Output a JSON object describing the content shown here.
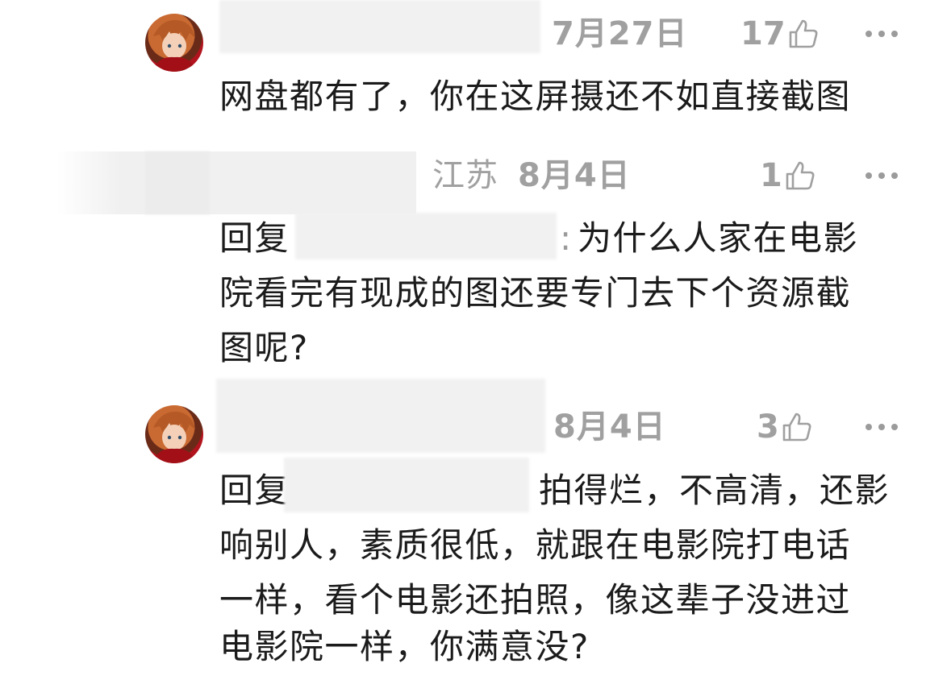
{
  "comments": [
    {
      "date": "7月27日",
      "likes": "17",
      "text": "网盘都有了，你在这屏摄还不如直接截图"
    },
    {
      "location": "江苏",
      "date": "8月4日",
      "likes": "1",
      "reply_prefix": "回复",
      "reply_colon": ":",
      "text_lines": [
        "为什么人家在电影",
        "院看完有现成的图还要专门去下个资源截",
        "图呢?"
      ]
    },
    {
      "date": "8月4日",
      "likes": "3",
      "reply_prefix": "回复",
      "text_lines": [
        "拍得烂，不高清，还影",
        "响别人，素质很低，就跟在电影院打电话",
        "一样，看个电影还拍照，像这辈子没进过",
        "电影院一样，你满意没?"
      ]
    }
  ],
  "colors": {
    "meta_text": "#a0a0a0",
    "body_text": "#1b1b1b",
    "redacted": "#f1f1f1"
  },
  "icons": [
    "avatar",
    "thumbs-up-icon",
    "more-icon"
  ]
}
